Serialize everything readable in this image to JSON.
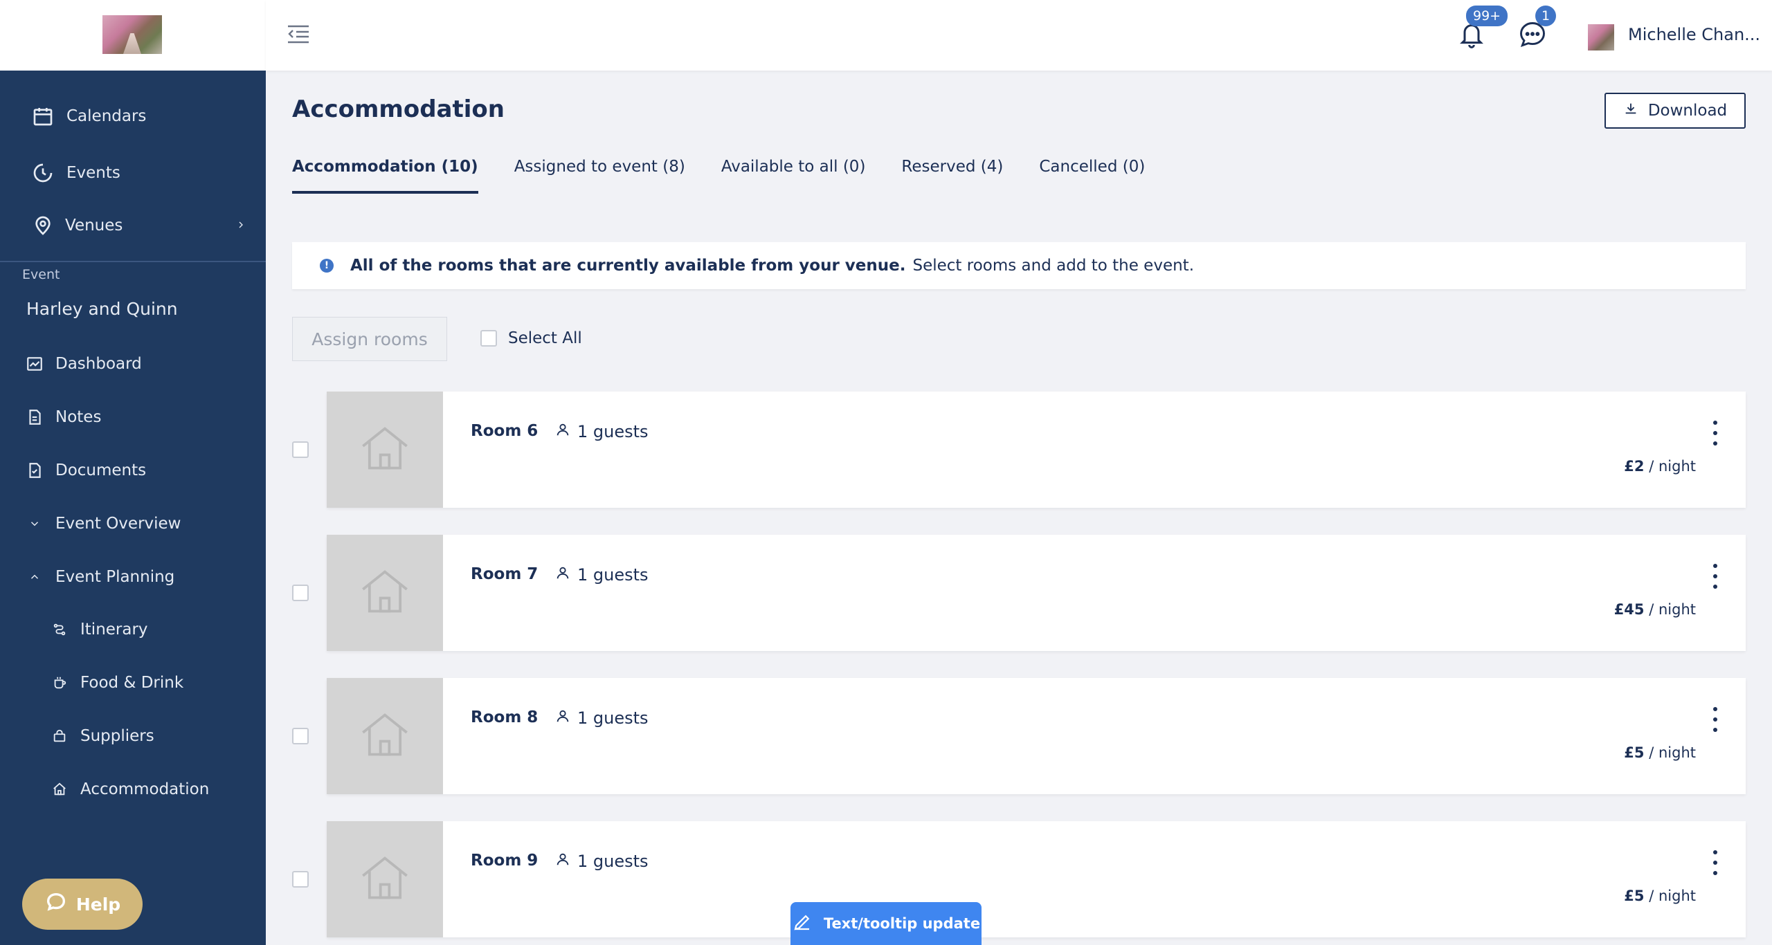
{
  "sidebar": {
    "nav": [
      {
        "label": "Calendars",
        "icon": "calendar-icon"
      },
      {
        "label": "Events",
        "icon": "events-icon"
      },
      {
        "label": "Venues",
        "icon": "location-pin-icon"
      }
    ],
    "section_label": "Event",
    "event_name": "Harley and Quinn",
    "event_nav": [
      {
        "label": "Dashboard",
        "icon": "chart-icon"
      },
      {
        "label": "Notes",
        "icon": "notes-icon"
      },
      {
        "label": "Documents",
        "icon": "documents-icon"
      },
      {
        "label": "Event Overview",
        "icon": "chevron-down-icon"
      },
      {
        "label": "Event Planning",
        "icon": "chevron-up-icon"
      },
      {
        "label": "Itinerary",
        "icon": "route-icon"
      },
      {
        "label": "Food & Drink",
        "icon": "cup-icon"
      },
      {
        "label": "Suppliers",
        "icon": "bag-icon"
      },
      {
        "label": "Accommodation",
        "icon": "home-icon"
      }
    ],
    "help_label": "Help"
  },
  "header": {
    "notifications_badge": "99+",
    "messages_badge": "1",
    "user_name": "Michelle Chan..."
  },
  "main": {
    "title": "Accommodation",
    "download_label": "Download",
    "tabs": [
      {
        "label": "Accommodation (10)",
        "active": true
      },
      {
        "label": "Assigned to event (8)",
        "active": false
      },
      {
        "label": "Available to all (0)",
        "active": false
      },
      {
        "label": "Reserved (4)",
        "active": false
      },
      {
        "label": "Cancelled (0)",
        "active": false
      }
    ],
    "info_strong": "All of the rooms that are currently available from your venue.",
    "info_text": "Select rooms and add to the event.",
    "assign_label": "Assign rooms",
    "select_all_label": "Select All",
    "rooms": [
      {
        "name": "Room 6",
        "guests": "1 guests",
        "price": "£2",
        "per": "/ night"
      },
      {
        "name": "Room 7",
        "guests": "1 guests",
        "price": "£45",
        "per": "/ night"
      },
      {
        "name": "Room 8",
        "guests": "1 guests",
        "price": "£5",
        "per": "/ night"
      },
      {
        "name": "Room 9",
        "guests": "1 guests",
        "price": "£5",
        "per": "/ night"
      }
    ]
  },
  "tooltip_update_label": "Text/tooltip update",
  "colors": {
    "sidebar": "#1f3a60",
    "accent": "#3f74c6",
    "help": "#d1b77a",
    "text": "#1c2f55"
  }
}
